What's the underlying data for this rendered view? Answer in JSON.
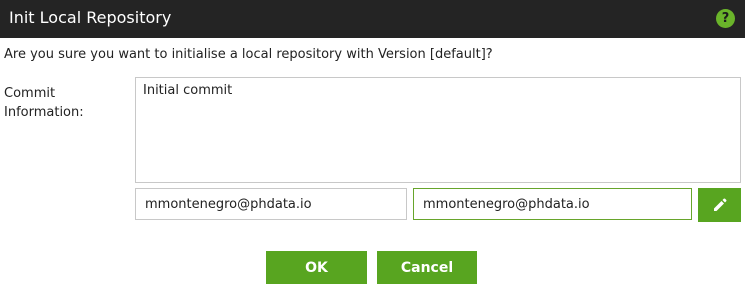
{
  "dialog": {
    "title": "Init Local Repository",
    "help_icon": "question-mark-icon",
    "help_glyph": "?"
  },
  "message": {
    "question": "Are you sure you want to initialise a local repository with Version [default]?"
  },
  "commit": {
    "label": "Commit Information:",
    "message_value": "Initial commit",
    "author_value": "mmontenegro@phdata.io",
    "committer_value": "mmontenegro@phdata.io",
    "edit_icon": "pencil-icon"
  },
  "buttons": {
    "ok_label": "OK",
    "cancel_label": "Cancel"
  },
  "colors": {
    "titlebar": "#242424",
    "accent_green": "#58a520"
  }
}
